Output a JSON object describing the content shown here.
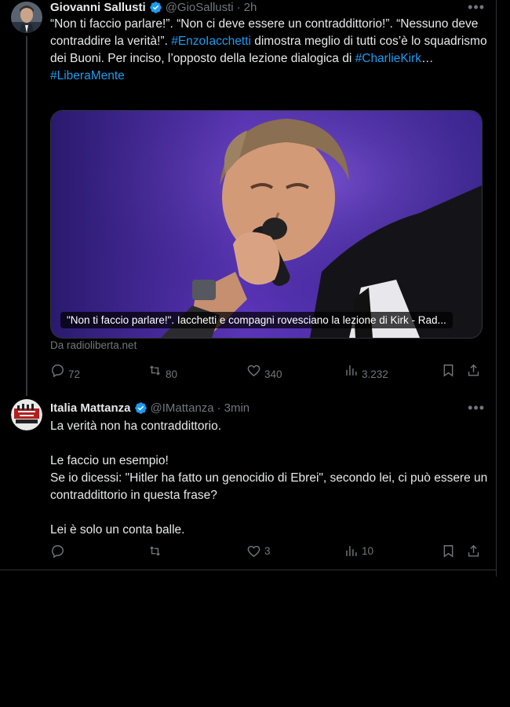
{
  "tweets": [
    {
      "author": "Giovanni Sallusti",
      "handle": "@GioSallusti",
      "time": "2h",
      "text_part1": "“Non ti faccio parlare!”. “Non ci deve essere un contraddittorio!”. “Nessuno deve contraddire la verità!”.",
      "hashtag1": "#EnzoIacchetti",
      "text_part2": "dimostra meglio di tutti cos’è lo squadrismo dei Buoni. Per inciso, l’opposto della lezione dialogica di",
      "hashtag2": "#CharlieKirk",
      "ellipsis": "…",
      "hashtag3": "#LiberaMente",
      "card_caption": "\"Non ti faccio parlare!\". Iacchetti e compagni rovesciano la lezione di Kirk - Rad...",
      "card_source": "Da radioliberta.net",
      "replies": "72",
      "reposts": "80",
      "likes": "340",
      "views": "3.232"
    },
    {
      "author": "Italia Mattanza",
      "handle": "@IMattanza",
      "time": "3min",
      "line1": "La verità non ha contraddittorio.",
      "line2": "Le faccio un esempio!",
      "line3": "Se io dicessi: \"Hitler ha fatto un genocidio di Ebrei\", secondo lei, ci può essere un contraddittorio in questa frase?",
      "line4": "Lei è solo un conta balle.",
      "replies": "",
      "reposts": "",
      "likes": "3",
      "views": "10"
    }
  ],
  "icons": {
    "more": "more-icon",
    "verified": "verified-badge-icon",
    "reply": "reply-icon",
    "repost": "repost-icon",
    "like": "like-icon",
    "views": "views-icon",
    "bookmark": "bookmark-icon",
    "share": "share-icon"
  },
  "colors": {
    "background": "#000000",
    "text": "#e7e9ea",
    "secondary": "#71767b",
    "link": "#1d9bf0",
    "verified": "#1d9bf0"
  }
}
